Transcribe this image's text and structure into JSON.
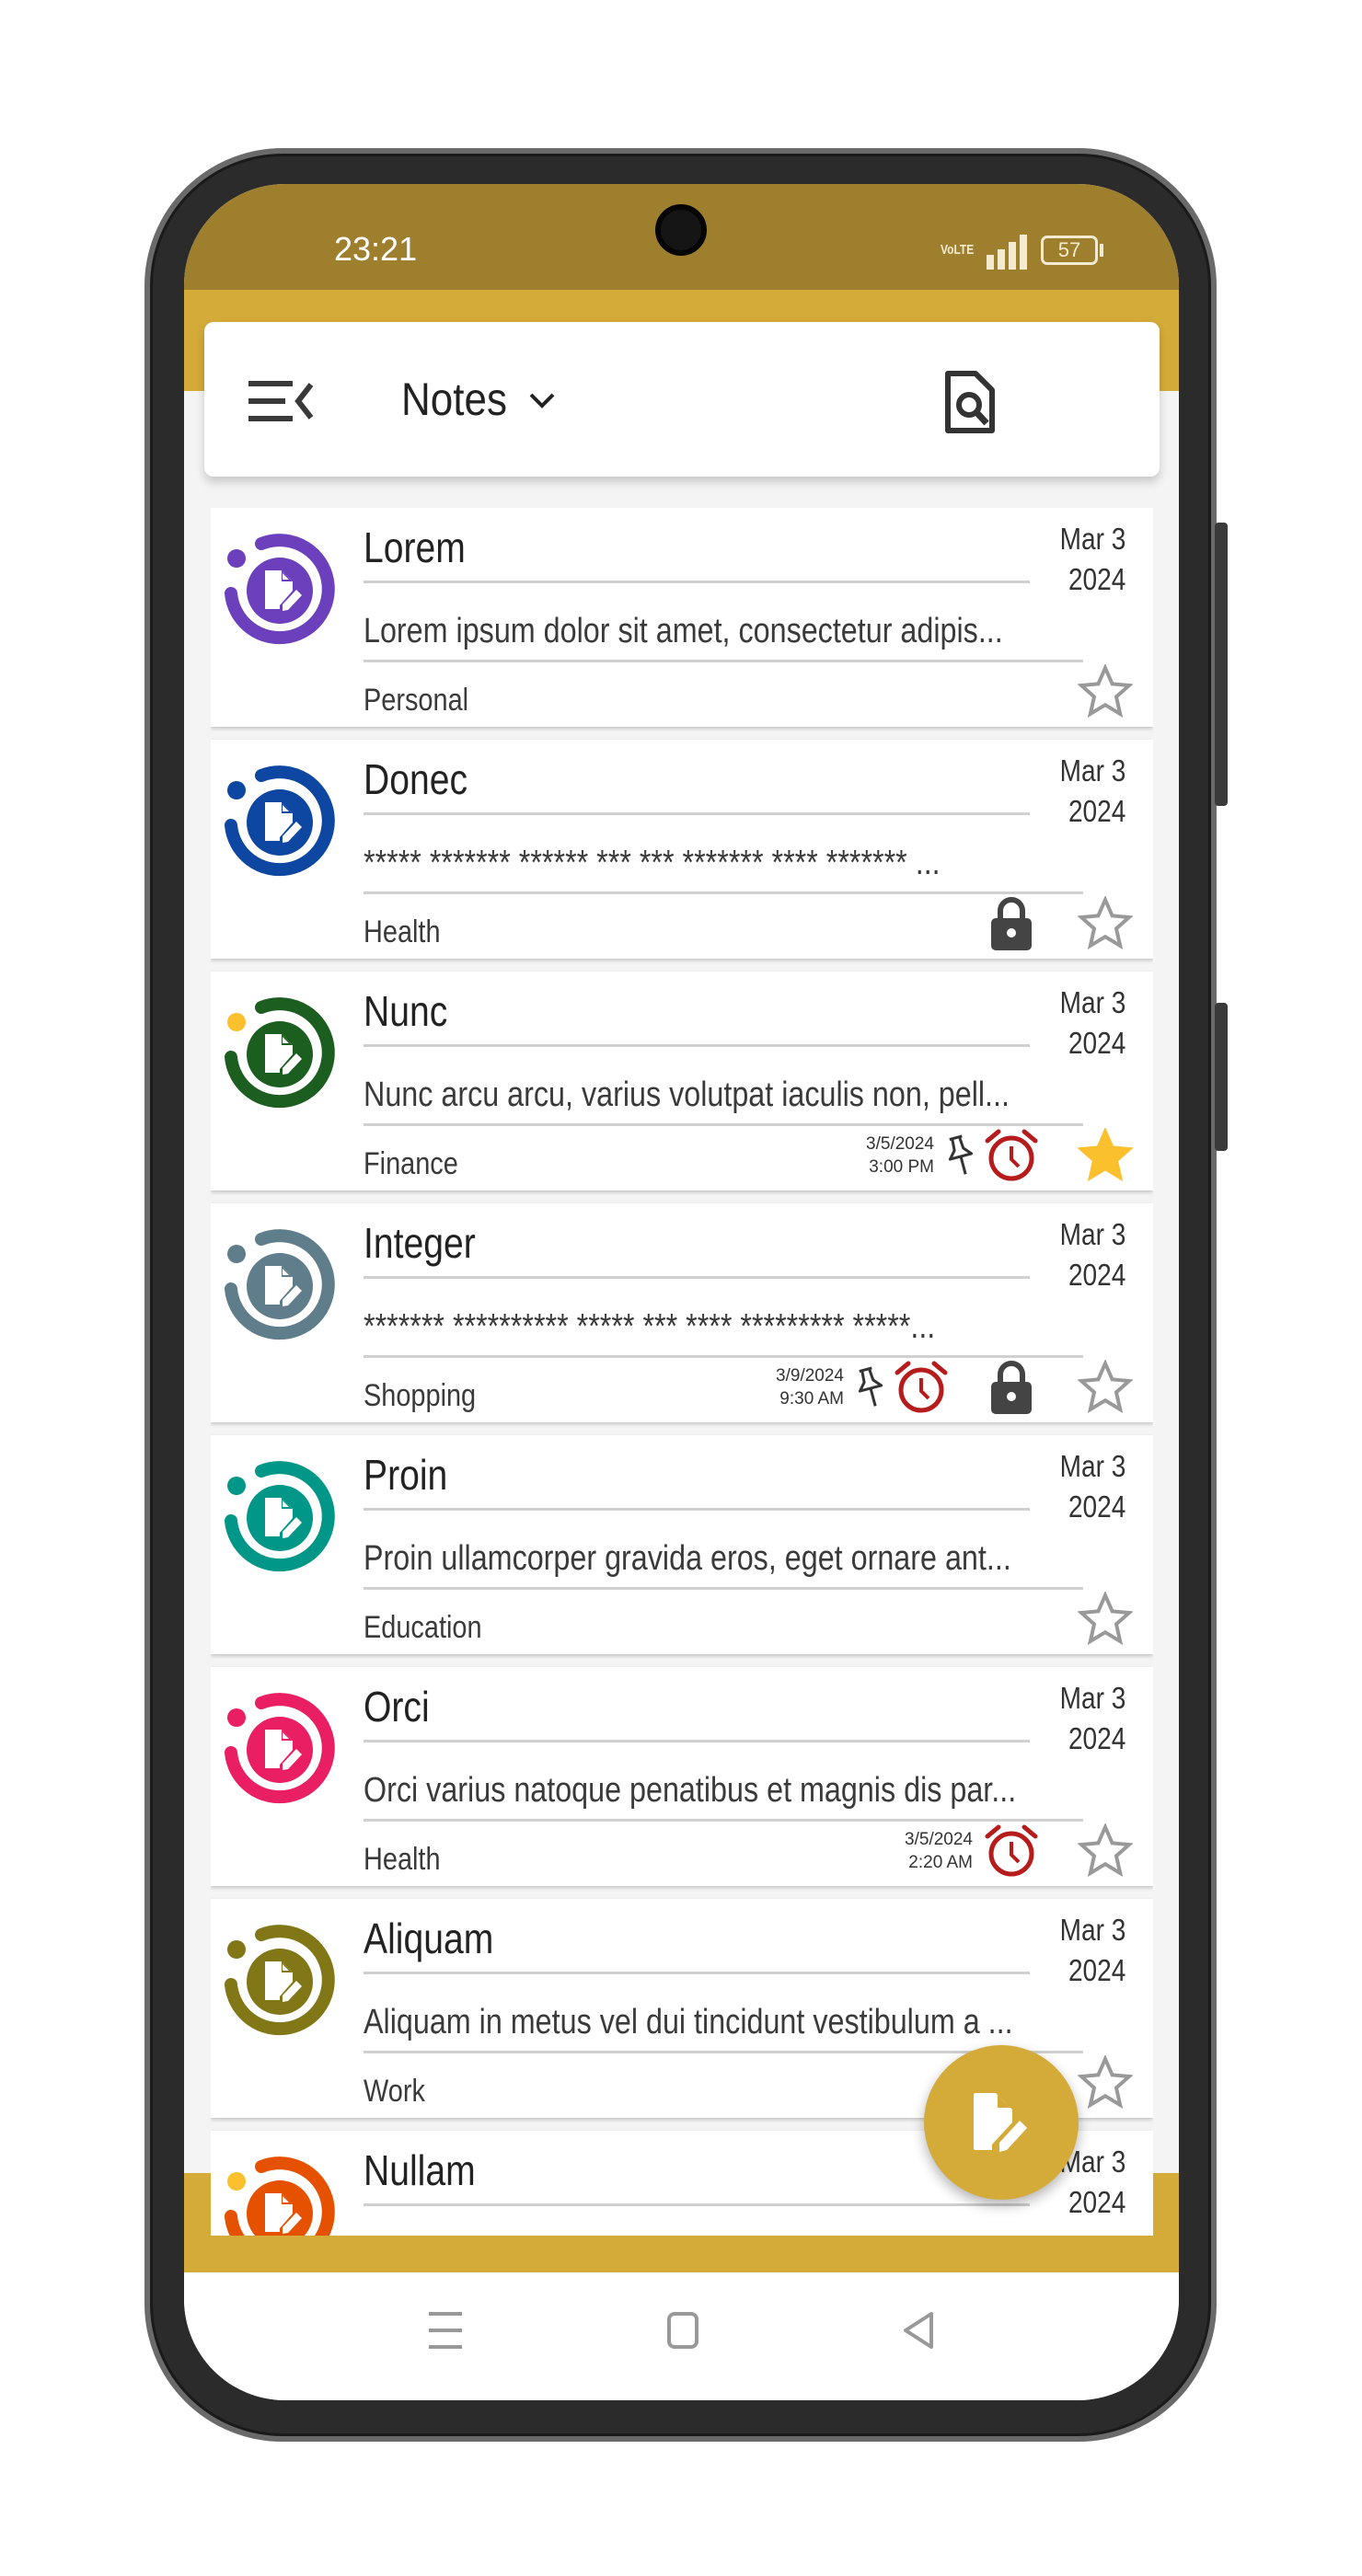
{
  "status_bar": {
    "time": "23:21",
    "network": "VoLTE",
    "battery": "57"
  },
  "toolbar": {
    "title": "Notes",
    "menu_icon": "menu-collapse-icon",
    "dropdown_icon": "chevron-down-icon",
    "search_icon": "document-search-icon",
    "more_icon": "more-vert-icon"
  },
  "colors": {
    "status_bar": "#9e7f2d",
    "accent": "#d4ab38",
    "star_filled": "#fbc02d",
    "alarm": "#b71c1c",
    "lock": "#444444"
  },
  "notes": [
    {
      "title": "Lorem",
      "date_line1": "Mar 3",
      "date_line2": "2024",
      "body": "Lorem ipsum dolor sit amet, consectetur adipis...",
      "category": "Personal",
      "color": "#6c3fbd",
      "dot": "#6c3fbd",
      "starred": false,
      "locked": false,
      "pinned": false,
      "alarm": false
    },
    {
      "title": "Donec",
      "date_line1": "Mar 3",
      "date_line2": "2024",
      "body": "***** ******* ****** *** *** ******* **** ******* ...",
      "category": "Health",
      "color": "#0d47a1",
      "dot": "#0d47a1",
      "starred": false,
      "locked": true,
      "pinned": false,
      "alarm": false
    },
    {
      "title": "Nunc",
      "date_line1": "Mar 3",
      "date_line2": "2024",
      "body": "Nunc arcu arcu, varius volutpat iaculis non, pell...",
      "category": "Finance",
      "color": "#1b5e20",
      "dot": "#fbc02d",
      "starred": true,
      "locked": false,
      "pinned": true,
      "alarm": true,
      "reminder_date": "3/5/2024",
      "reminder_time": "3:00 PM"
    },
    {
      "title": "Integer",
      "date_line1": "Mar 3",
      "date_line2": "2024",
      "body": "******* ********** ***** *** **** ********* *****...",
      "category": "Shopping",
      "color": "#607d8b",
      "dot": "#607d8b",
      "starred": false,
      "locked": true,
      "pinned": true,
      "alarm": true,
      "reminder_date": "3/9/2024",
      "reminder_time": "9:30 AM"
    },
    {
      "title": "Proin",
      "date_line1": "Mar 3",
      "date_line2": "2024",
      "body": "Proin ullamcorper gravida eros, eget ornare ant...",
      "category": "Education",
      "color": "#009688",
      "dot": "#009688",
      "starred": false,
      "locked": false,
      "pinned": false,
      "alarm": false
    },
    {
      "title": "Orci",
      "date_line1": "Mar 3",
      "date_line2": "2024",
      "body": "Orci varius natoque penatibus et magnis dis par...",
      "category": "Health",
      "color": "#e91e63",
      "dot": "#e91e63",
      "starred": false,
      "locked": false,
      "pinned": false,
      "alarm": true,
      "reminder_date": "3/5/2024",
      "reminder_time": "2:20 AM"
    },
    {
      "title": "Aliquam",
      "date_line1": "Mar 3",
      "date_line2": "2024",
      "body": "Aliquam in metus vel dui tincidunt vestibulum a ...",
      "category": "Work",
      "color": "#827717",
      "dot": "#827717",
      "starred": false,
      "locked": false,
      "pinned": false,
      "alarm": false
    },
    {
      "title": "Nullam",
      "date_line1": "Mar 3",
      "date_line2": "2024",
      "body": "",
      "category": "",
      "color": "#e65100",
      "dot": "#fbc02d",
      "starred": false,
      "locked": false,
      "pinned": false,
      "alarm": false
    }
  ],
  "fab": {
    "icon": "new-note-icon"
  },
  "nav": {
    "recents_icon": "recents-icon",
    "home_icon": "home-icon",
    "back_icon": "back-icon"
  }
}
